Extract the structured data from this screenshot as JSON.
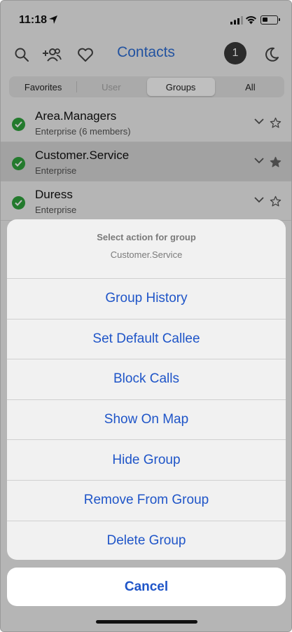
{
  "status": {
    "time": "11:18"
  },
  "toolbar": {
    "title": "Contacts",
    "notification_count": "1"
  },
  "tabs": [
    {
      "label": "Favorites",
      "state": "normal"
    },
    {
      "label": "User",
      "state": "disabled"
    },
    {
      "label": "Groups",
      "state": "selected"
    },
    {
      "label": "All",
      "state": "normal"
    }
  ],
  "groups": [
    {
      "name": "Area.Managers",
      "subtitle": "Enterprise (6 members)",
      "status": "online",
      "favorite": false
    },
    {
      "name": "Customer.Service",
      "subtitle": "Enterprise",
      "status": "online",
      "favorite": true
    },
    {
      "name": "Duress",
      "subtitle": "Enterprise",
      "status": "online",
      "favorite": false
    }
  ],
  "sheet": {
    "title": "Select action for group",
    "subtitle": "Customer.Service",
    "actions": [
      "Group History",
      "Set Default Callee",
      "Block Calls",
      "Show On Map",
      "Hide Group",
      "Remove From Group",
      "Delete Group"
    ],
    "cancel_label": "Cancel"
  },
  "colors": {
    "accent": "#2f6fd6",
    "action_text": "#1f55c8",
    "online": "#2fa33d"
  },
  "icons": [
    "location-arrow-icon",
    "search-icon",
    "add-group-icon",
    "heart-icon",
    "moon-icon",
    "checkmark-icon",
    "chevron-down-icon",
    "star-icon"
  ]
}
